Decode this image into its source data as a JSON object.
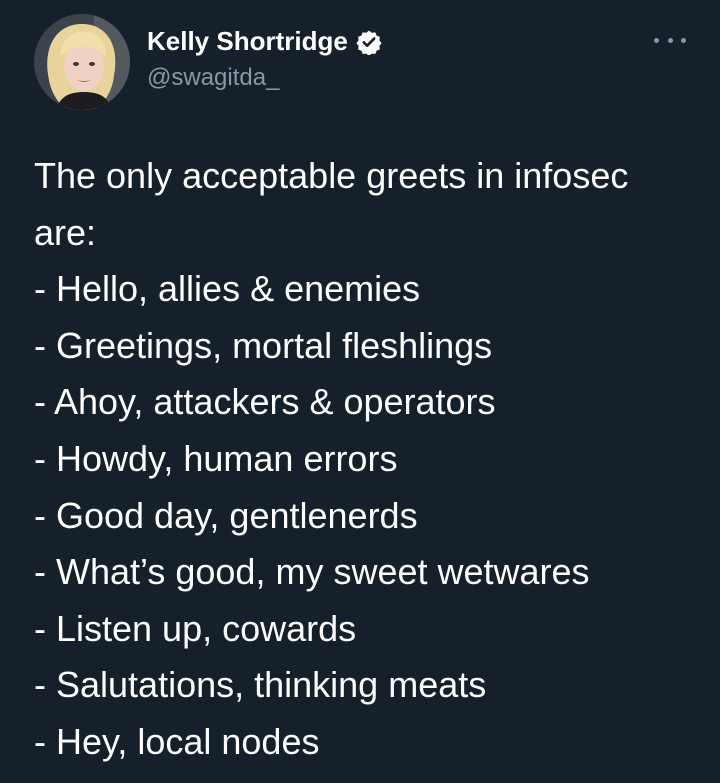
{
  "tweet": {
    "author": {
      "display_name": "Kelly Shortridge",
      "handle": "@swagitda_",
      "verified": true,
      "avatar_icon": "profile-photo"
    },
    "more_icon": "more-horizontal-icon",
    "lines": [
      "The only acceptable greets in infosec",
      "are:",
      "- Hello, allies & enemies",
      "- Greetings, mortal fleshlings",
      "- Ahoy, attackers & operators",
      "- Howdy, human errors",
      "- Good day, gentlenerds",
      "- What’s good, my sweet wetwares",
      "- Listen up, cowards",
      "- Salutations, thinking meats",
      "- Hey, local nodes"
    ]
  },
  "colors": {
    "background": "#15202b",
    "text_primary": "#ffffff",
    "text_secondary": "#8899a6"
  }
}
